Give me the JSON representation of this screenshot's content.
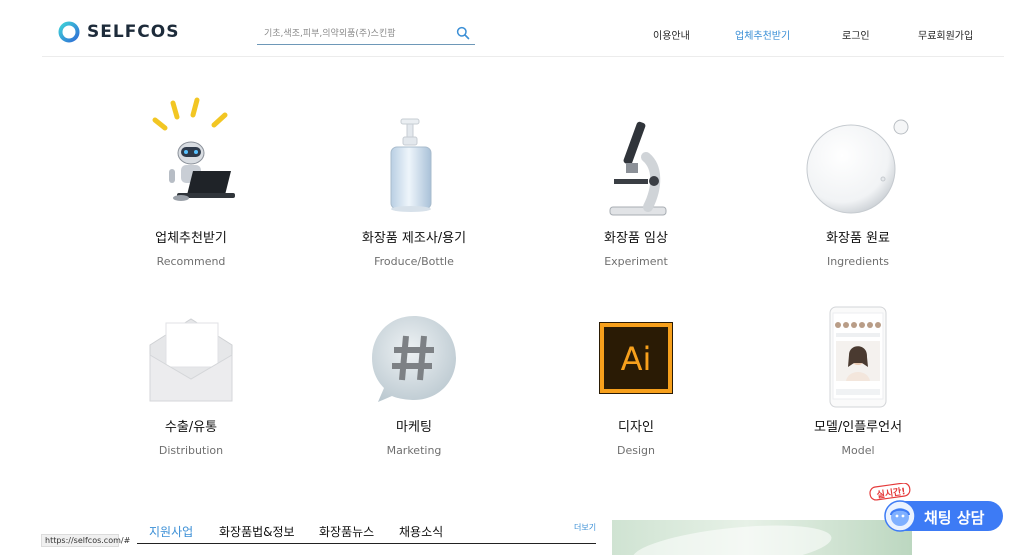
{
  "brand": {
    "name": "SELFCOS"
  },
  "search": {
    "placeholder": "기초,색조,피부,의약외품(주)스킨팜"
  },
  "nav": [
    "이용안내",
    "업체추천받기",
    "로그인",
    "무료회원가입"
  ],
  "categories": [
    {
      "title": "업체추천받기",
      "subtitle": "Recommend",
      "icon": "robot-icon"
    },
    {
      "title": "화장품 제조사/용기",
      "subtitle": "Froduce/Bottle",
      "icon": "pump-bottle-icon"
    },
    {
      "title": "화장품 임상",
      "subtitle": "Experiment",
      "icon": "microscope-icon"
    },
    {
      "title": "화장품 원료",
      "subtitle": "Ingredients",
      "icon": "bubble-icon"
    },
    {
      "title": "수출/유통",
      "subtitle": "Distribution",
      "icon": "envelope-icon"
    },
    {
      "title": "마케팅",
      "subtitle": "Marketing",
      "icon": "hashtag-icon"
    },
    {
      "title": "디자인",
      "subtitle": "Design",
      "icon": "illustrator-icon"
    },
    {
      "title": "모델/인플루언서",
      "subtitle": "Model",
      "icon": "phone-model-icon"
    }
  ],
  "tabs": [
    "지원사업",
    "화장품법&정보",
    "화장품뉴스",
    "채용소식"
  ],
  "more_label": "더보기",
  "status_url": "https://selfcos.com/#",
  "chat": {
    "label": "채팅 상담",
    "badge": "실시간!"
  },
  "colors": {
    "accent": "#3b8fd6",
    "chat_button": "#3d7bf5",
    "badge": "#e53a3a"
  }
}
